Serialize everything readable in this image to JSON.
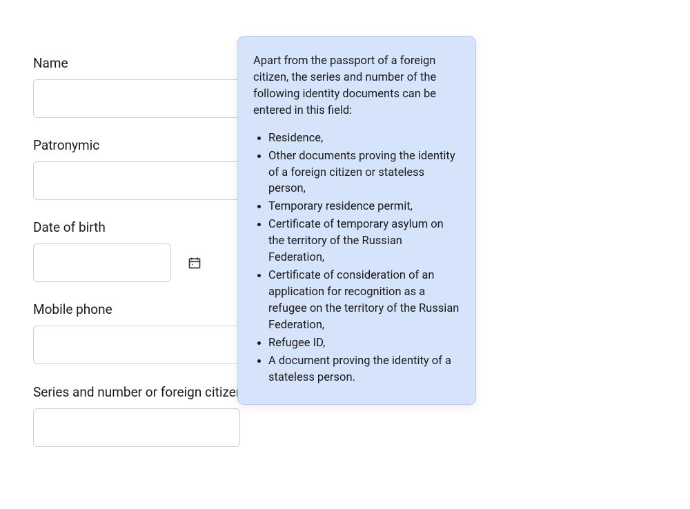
{
  "form": {
    "name": {
      "label": "Name",
      "value": ""
    },
    "patronymic": {
      "label": "Patronymic",
      "value": ""
    },
    "dob": {
      "label": "Date of birth",
      "value": ""
    },
    "mobile": {
      "label": "Mobile phone",
      "value": ""
    },
    "passport": {
      "label": "Series and number or foreign citizen passport",
      "value": ""
    }
  },
  "tooltip": {
    "intro": "Apart from the passport of a foreign citizen, the series and number of the following identity documents can be entered in this field:",
    "items": [
      "Residence,",
      "Other documents proving the identity of a foreign citizen or stateless person,",
      "Temporary residence permit,",
      "Certificate of temporary asylum on the territory of the Russian Federation,",
      "Certificate of consideration of an application for recognition as a refugee on the territory of the Russian Federation,",
      "Refugee ID,",
      "A document proving the identity of a stateless person."
    ]
  }
}
